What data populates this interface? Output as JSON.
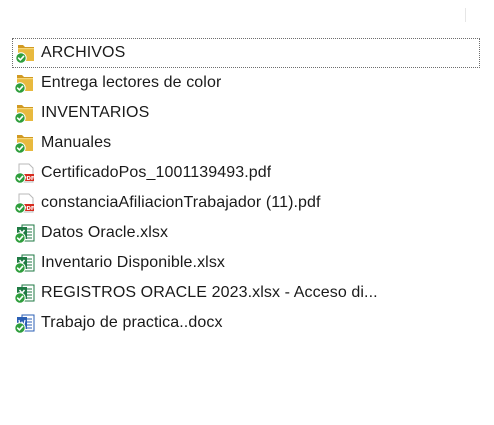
{
  "colors": {
    "folder": "#e8b93e",
    "folder_dark": "#d19a22",
    "sync_green": "#2e9e3c",
    "pdf_red": "#d62b1e",
    "excel_green": "#1f7a43",
    "word_blue": "#2b5fb4"
  },
  "files": [
    {
      "name": "ARCHIVOS",
      "icon": "folder-icon",
      "selected": true
    },
    {
      "name": "Entrega lectores de color",
      "icon": "folder-icon",
      "selected": false
    },
    {
      "name": "INVENTARIOS",
      "icon": "folder-icon",
      "selected": false
    },
    {
      "name": "Manuales",
      "icon": "folder-icon",
      "selected": false
    },
    {
      "name": "CertificadoPos_1001139493.pdf",
      "icon": "pdf-file-icon",
      "selected": false
    },
    {
      "name": "constanciaAfiliacionTrabajador (11).pdf",
      "icon": "pdf-file-icon",
      "selected": false
    },
    {
      "name": "Datos Oracle.xlsx",
      "icon": "excel-file-icon",
      "selected": false
    },
    {
      "name": "Inventario Disponible.xlsx",
      "icon": "excel-file-icon",
      "selected": false
    },
    {
      "name": "REGISTROS ORACLE 2023.xlsx - Acceso di...",
      "icon": "excel-file-icon",
      "selected": false
    },
    {
      "name": "Trabajo de practica..docx",
      "icon": "word-file-icon",
      "selected": false
    }
  ]
}
